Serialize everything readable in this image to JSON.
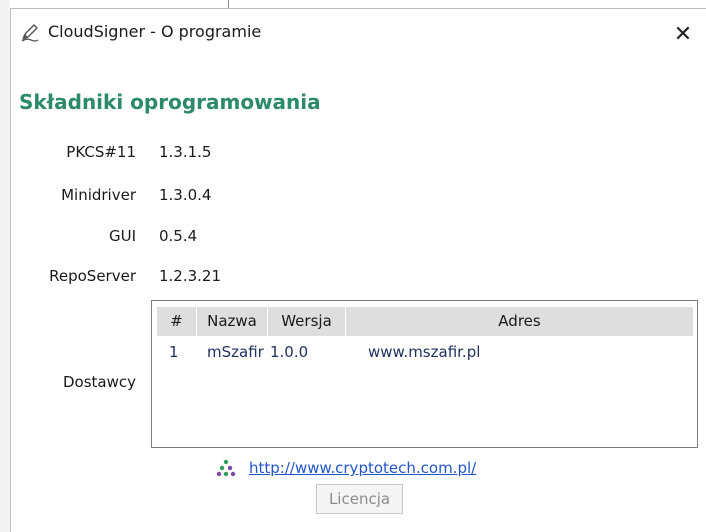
{
  "window": {
    "title": "CloudSigner - O programie",
    "close_glyph": "✕"
  },
  "section": {
    "title": "Składniki oprogramowania"
  },
  "components": [
    {
      "label": "PKCS#11",
      "value": "1.3.1.5"
    },
    {
      "label": "Minidriver",
      "value": "1.3.0.4"
    },
    {
      "label": "GUI",
      "value": "0.5.4"
    },
    {
      "label": "RepoServer",
      "value": "1.2.3.21"
    }
  ],
  "suppliers": {
    "label": "Dostawcy",
    "columns": [
      "#",
      "Nazwa",
      "Wersja",
      "Adres"
    ],
    "rows": [
      {
        "num": "1",
        "name": "mSzafir",
        "version": "1.0.0",
        "address": "www.mszafir.pl"
      }
    ]
  },
  "footer": {
    "link_text": "http://www.cryptotech.com.pl/",
    "license_button": "Licencja"
  },
  "colors": {
    "section_title": "#2a8a6a",
    "link": "#2255cc",
    "header_bg": "#dedede"
  },
  "icons": {
    "title": "pen-icon",
    "close": "close-icon",
    "link": "cryptotech-logo-icon"
  }
}
